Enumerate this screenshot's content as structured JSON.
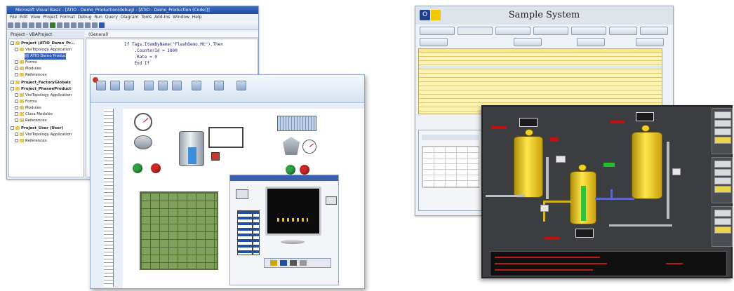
{
  "editor_window": {
    "title": "Microsoft Visual Basic - [ATIO - Demo_Production(debug) - [ATIO - Demo_Production (Code)]]",
    "menus": [
      "File",
      "Edit",
      "View",
      "Project",
      "Format",
      "Debug",
      "Run",
      "Query",
      "Diagram",
      "Tools",
      "Add-Ins",
      "Window",
      "Help"
    ],
    "tree_header": "Project - VBAProject",
    "tree_items": [
      "Project (ATIO_Demo_Pr...",
      "VisiTopology Application",
      "ATIO Demo Produc",
      "Forms",
      "Modules",
      "References",
      "Project_FactoryGlobals",
      "Project_PhaseeProduct",
      "VisiTopology Application",
      "Forms",
      "Modules",
      "Class Modules",
      "References",
      "Project_User (User)",
      "VisiTopology Application",
      "References"
    ],
    "code_header": "(General)",
    "code_lines": [
      "If Tags.ItemByName(\"FlashDemo.Mt\").Then",
      "    .CounterId = 1000",
      "    .Rate = 0",
      "    End If"
    ]
  },
  "sample_system": {
    "title": "Sample System",
    "logo_letter": "O"
  }
}
